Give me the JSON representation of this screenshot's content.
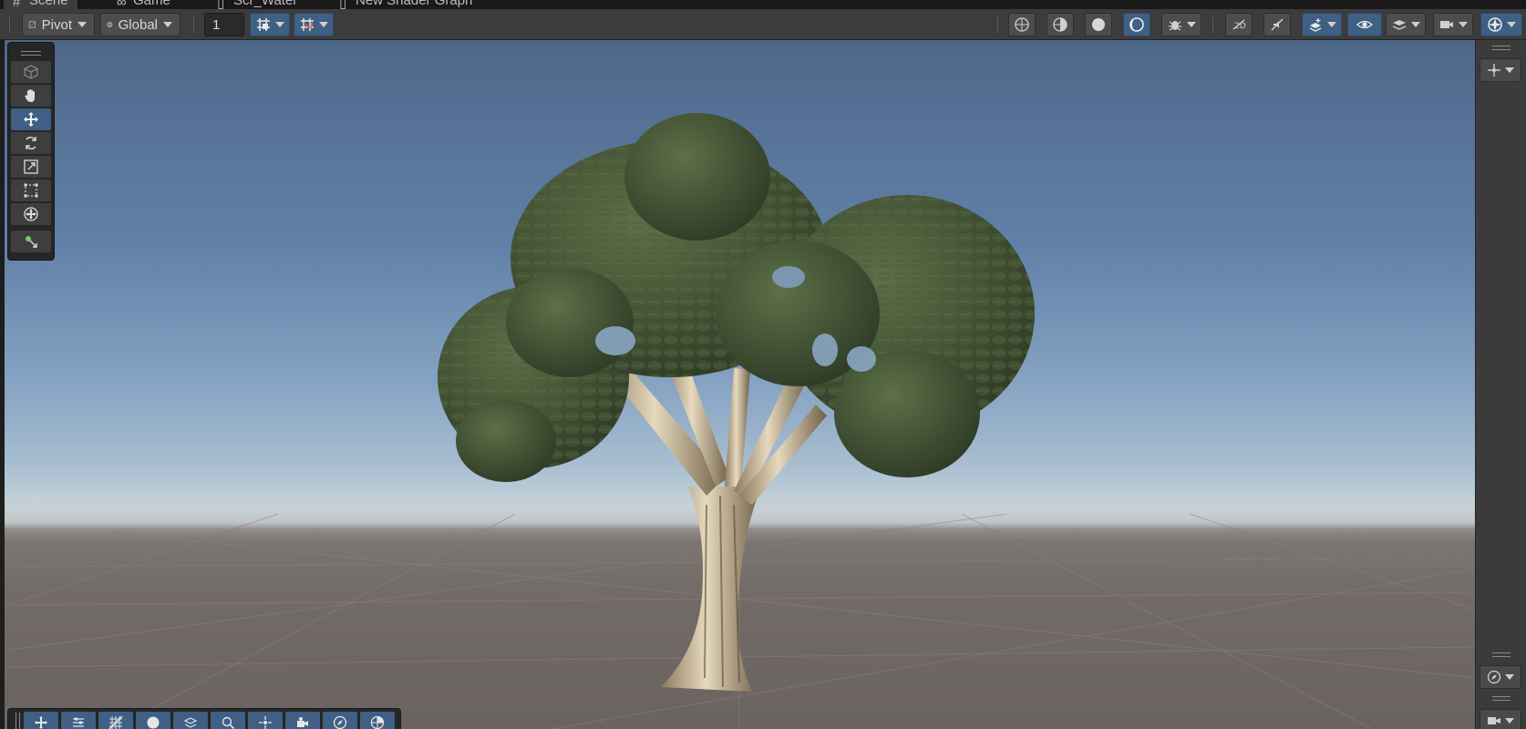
{
  "tabs": [
    {
      "label": "Scene",
      "icon": "scene-icon"
    },
    {
      "label": "Game",
      "icon": "game-icon"
    },
    {
      "label": "Scr_Water",
      "icon": "script-icon"
    },
    {
      "label": "New Shader Graph",
      "icon": "shader-icon"
    }
  ],
  "toolbar": {
    "pivot_label": "Pivot",
    "global_label": "Global",
    "grid_size_value": "1",
    "left_icons": [
      "grid-snap-icon",
      "increment-snap-icon"
    ],
    "right_icons": [
      "wireframe-shading-icon",
      "shaded-wireframe-icon",
      "shaded-icon",
      "lighting-icon",
      "debug-draw-mode-icon",
      "2d-toggle-icon",
      "audio-toggle-icon",
      "effects-icon",
      "visibility-icon",
      "layers-icon",
      "camera-icon",
      "gizmos-icon"
    ]
  },
  "tools": {
    "items": [
      {
        "name": "view-cube-icon",
        "active": false
      },
      {
        "name": "hand-tool-icon",
        "active": false
      },
      {
        "name": "move-tool-icon",
        "active": true
      },
      {
        "name": "rotate-tool-icon",
        "active": false
      },
      {
        "name": "scale-tool-icon",
        "active": false
      },
      {
        "name": "rect-tool-icon",
        "active": false
      },
      {
        "name": "transform-tool-icon",
        "active": false
      },
      {
        "name": "custom-tool-icon",
        "active": false
      }
    ]
  },
  "bottom_tools": [
    "move-handle-icon",
    "tool-settings-icon",
    "grid-icon",
    "sphere-icon",
    "layers-toggle-icon",
    "search-icon",
    "pivot-icon",
    "camera-icon",
    "orientation-icon",
    "sphere-grid-icon"
  ],
  "colors": {
    "accent": "#3f5f84",
    "toolbar": "#3c3c3c",
    "panel": "#262626"
  }
}
